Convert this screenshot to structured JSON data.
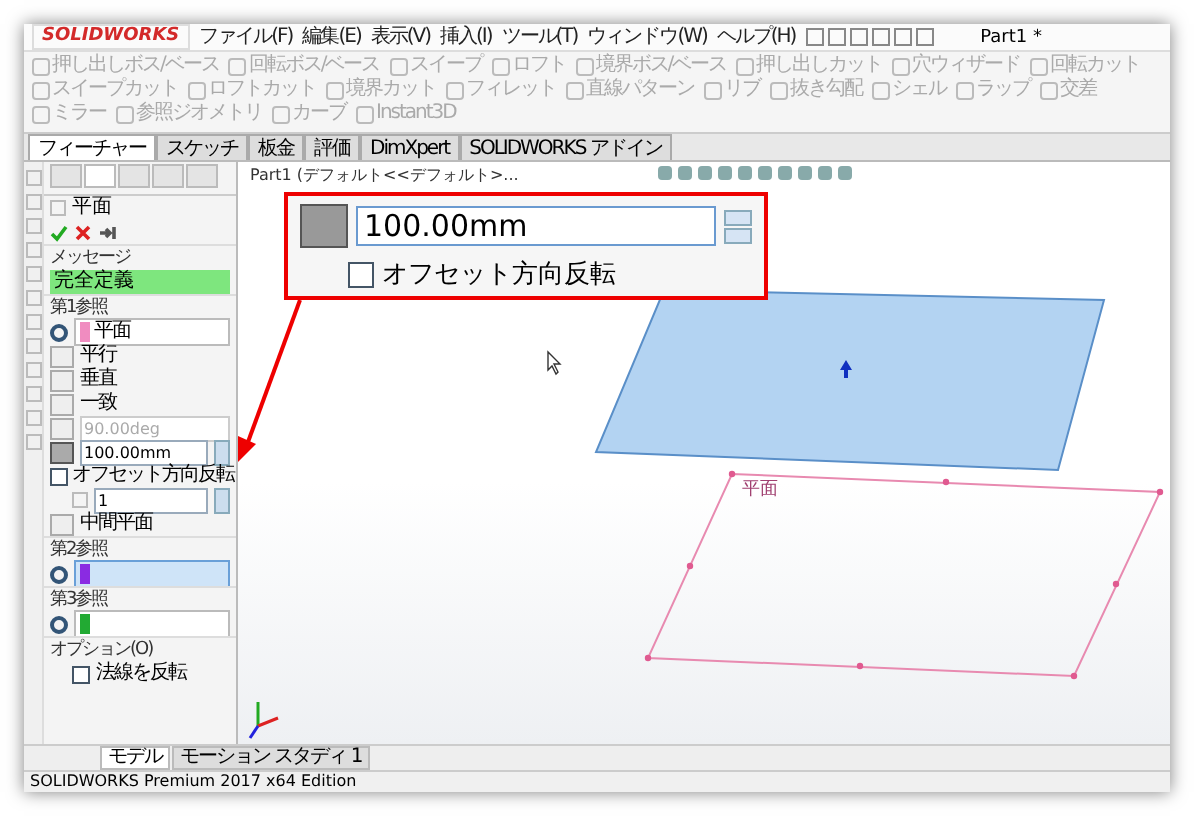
{
  "window": {
    "logo": "SOLIDWORKS",
    "title": "Part1 *"
  },
  "menu": [
    {
      "label": "ファイル(F)"
    },
    {
      "label": "編集(E)"
    },
    {
      "label": "表示(V)"
    },
    {
      "label": "挿入(I)"
    },
    {
      "label": "ツール(T)"
    },
    {
      "label": "ウィンドウ(W)"
    },
    {
      "label": "ヘルプ(H)"
    }
  ],
  "ribbon": [
    {
      "label": "押し出しボス/ベース",
      "disabled": true
    },
    {
      "label": "回転ボス/ベース",
      "disabled": true
    },
    {
      "label": "スイープ",
      "disabled": true
    },
    {
      "label": "ロフト",
      "disabled": true
    },
    {
      "label": "境界ボス/ベース",
      "disabled": true
    },
    {
      "label": "押し出しカット",
      "disabled": true
    },
    {
      "label": "穴ウィザード",
      "disabled": true
    },
    {
      "label": "回転カット",
      "disabled": true
    },
    {
      "label": "スイープカット",
      "disabled": true
    },
    {
      "label": "ロフトカット",
      "disabled": true
    },
    {
      "label": "境界カット",
      "disabled": true
    },
    {
      "label": "フィレット",
      "disabled": true
    },
    {
      "label": "直線パターン",
      "disabled": true
    },
    {
      "label": "リブ",
      "disabled": true
    },
    {
      "label": "抜き勾配",
      "disabled": true
    },
    {
      "label": "シェル",
      "disabled": true
    },
    {
      "label": "ラップ",
      "disabled": true
    },
    {
      "label": "交差",
      "disabled": true
    },
    {
      "label": "ミラー",
      "disabled": true
    },
    {
      "label": "参照ジオメトリ",
      "disabled": true
    },
    {
      "label": "カーブ",
      "disabled": true
    },
    {
      "label": "Instant3D",
      "disabled": true
    }
  ],
  "command_tabs": [
    {
      "label": "フィーチャー",
      "selected": true
    },
    {
      "label": "スケッチ",
      "selected": false
    },
    {
      "label": "板金",
      "selected": false
    },
    {
      "label": "評価",
      "selected": false
    },
    {
      "label": "DimXpert",
      "selected": false
    },
    {
      "label": "SOLIDWORKS アドイン",
      "selected": false
    }
  ],
  "property_manager": {
    "tabs": [
      {
        "selected": false
      },
      {
        "selected": true
      },
      {
        "selected": false
      },
      {
        "selected": false
      },
      {
        "selected": false
      }
    ],
    "title": "平面",
    "message_header": "メッセージ",
    "message": "完全定義",
    "first_reference": {
      "title": "第1参照",
      "reference": "平面",
      "color": "#f08cc0",
      "constraints": [
        {
          "kind": "toggle",
          "label": "平行",
          "selected": false
        },
        {
          "kind": "toggle",
          "label": "垂直",
          "selected": false
        },
        {
          "kind": "toggle",
          "label": "一致",
          "selected": false
        },
        {
          "kind": "value",
          "value": "90.00deg",
          "selected": false,
          "disabled": true
        },
        {
          "kind": "value",
          "value": "100.00mm",
          "selected": true,
          "disabled": false
        }
      ],
      "flip_offset": {
        "label": "オフセット方向反転",
        "checked": false
      },
      "count": "1",
      "mid_plane": "中間平面"
    },
    "second_reference": {
      "title": "第2参照",
      "color": "#8a2be2",
      "selected": true
    },
    "third_reference": {
      "title": "第3参照",
      "color": "#22aa33",
      "selected": false
    },
    "options": {
      "title": "オプション(O)",
      "flip_normal": {
        "label": "法線を反転",
        "checked": false
      }
    }
  },
  "graphics": {
    "breadcrumb": "Part1 (デフォルト<<デフォルト>...",
    "plane_label": "平面",
    "callout": {
      "value": "100.00mm",
      "flip_label": "オフセット方向反転",
      "flip_checked": false
    }
  },
  "bottom_tabs": [
    {
      "label": "モデル",
      "selected": true
    },
    {
      "label": "モーション スタディ 1",
      "selected": false
    }
  ],
  "status_bar": "SOLIDWORKS Premium 2017 x64 Edition"
}
